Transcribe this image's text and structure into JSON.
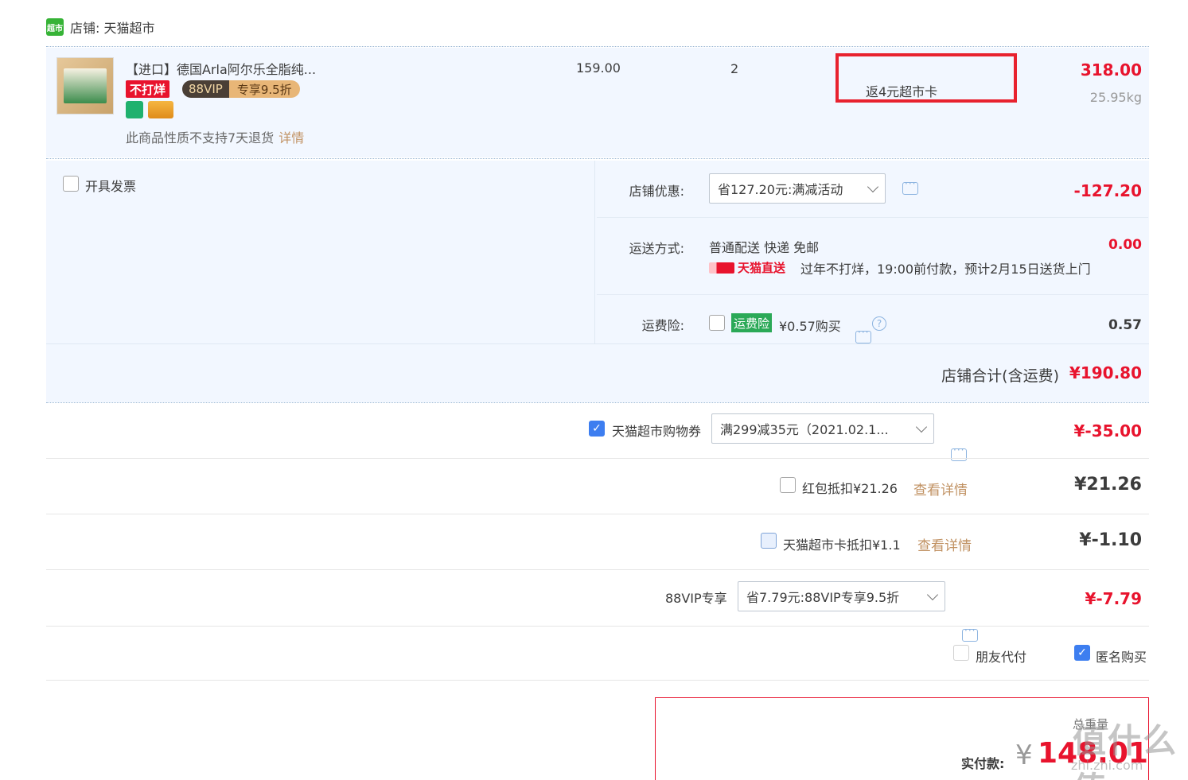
{
  "shop": {
    "logo": "超市",
    "name": "店铺: 天猫超市"
  },
  "product": {
    "title": "【进口】德国Arla阿尔乐全脂纯...",
    "tag_no_break": "不打烊",
    "vip_a": "88VIP",
    "vip_b": "专享9.5折",
    "no_return": "此商品性质不支持7天退货",
    "no_return_link": "详情",
    "price": "159.00",
    "quantity": "2",
    "rebate": "返4元超市卡",
    "line_total": "318.00",
    "weight": "25.95kg"
  },
  "invoice": {
    "label": "开具发票"
  },
  "store_discount": {
    "label": "店铺优惠:",
    "value": "省127.20元:满减活动",
    "amount": "-127.20"
  },
  "shipping": {
    "label": "运送方式:",
    "method": "普通配送 快递 免邮",
    "badge": "天猫直送",
    "note": "过年不打烊，19:00前付款，预计2月15日送货上门",
    "amount": "0.00"
  },
  "insurance": {
    "label": "运费险:",
    "tag": "运费险",
    "price": "¥0.57购买",
    "amount": "0.57"
  },
  "shop_total": {
    "label": "店铺合计(含运费)",
    "value": "¥190.80"
  },
  "coupon": {
    "label": "天猫超市购物券",
    "value": "满299减35元（2021.02.1...",
    "amount": "¥-35.00"
  },
  "red_packet": {
    "label": "红包抵扣¥21.26",
    "link": "查看详情",
    "amount": "¥21.26"
  },
  "market_card": {
    "label": "天猫超市卡抵扣¥1.1",
    "link": "查看详情",
    "amount": "¥-1.10"
  },
  "vip_discount": {
    "label": "88VIP专享",
    "value": "省7.79元:88VIP专享9.5折",
    "amount": "¥-7.79"
  },
  "friend_pay": {
    "label": "朋友代付"
  },
  "anonymous": {
    "label": "匿名购买"
  },
  "summary": {
    "weight_label": "总重量",
    "pay_label": "实付款:",
    "yen": "¥",
    "amount": "148.01"
  },
  "watermark": {
    "main": "值什么值",
    "sub": "zhi.zhi.com"
  }
}
